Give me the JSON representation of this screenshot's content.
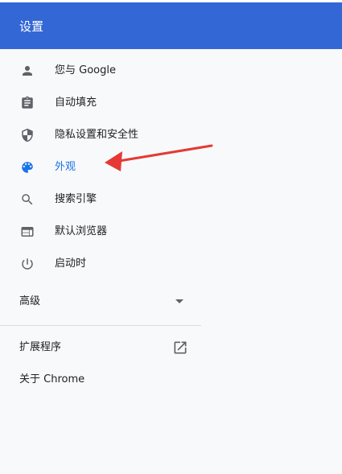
{
  "header": {
    "title": "设置"
  },
  "colors": {
    "header_bg": "#3367d6",
    "accent": "#1a73e8",
    "arrow": "#e53935"
  },
  "menu": [
    {
      "id": "you-and-google",
      "label": "您与 Google",
      "icon": "person-icon",
      "active": false
    },
    {
      "id": "autofill",
      "label": "自动填充",
      "icon": "clipboard-icon",
      "active": false
    },
    {
      "id": "privacy",
      "label": "隐私设置和安全性",
      "icon": "shield-icon",
      "active": false
    },
    {
      "id": "appearance",
      "label": "外观",
      "icon": "palette-icon",
      "active": true
    },
    {
      "id": "search-engine",
      "label": "搜索引擎",
      "icon": "search-icon",
      "active": false
    },
    {
      "id": "default-browser",
      "label": "默认浏览器",
      "icon": "browser-icon",
      "active": false
    },
    {
      "id": "on-startup",
      "label": "启动时",
      "icon": "power-icon",
      "active": false
    }
  ],
  "advanced": {
    "label": "高级",
    "icon": "caret-down-icon"
  },
  "extensions": {
    "label": "扩展程序",
    "icon": "open-in-new-icon"
  },
  "about": {
    "label": "关于 Chrome"
  },
  "annotation": {
    "type": "arrow",
    "points_to": "appearance"
  }
}
